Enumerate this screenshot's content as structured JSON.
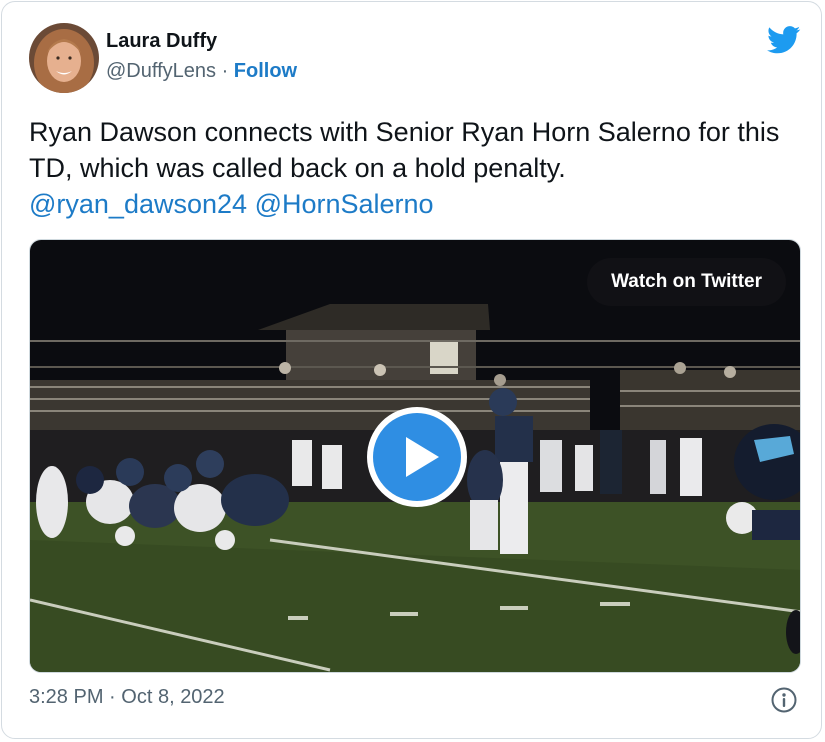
{
  "author": {
    "name": "Laura Duffy",
    "handle": "@DuffyLens",
    "separator": "·",
    "follow_label": "Follow"
  },
  "tweet": {
    "text": "Ryan Dawson connects with Senior Ryan Horn Salerno for this TD, which was called back on a hold penalty.",
    "mentions": [
      "@ryan_dawson24",
      "@HornSalerno"
    ]
  },
  "media": {
    "watch_label": "Watch on Twitter"
  },
  "meta": {
    "time": "3:28 PM",
    "separator": "·",
    "date": "Oct 8, 2022"
  },
  "icons": {
    "brand": "twitter-bird-icon",
    "play": "play-icon",
    "info": "info-icon"
  },
  "colors": {
    "link": "#1d7bc7",
    "brand": "#1d9bf0",
    "play": "#2f8ee3",
    "muted": "#536471",
    "text": "#0f1419"
  }
}
